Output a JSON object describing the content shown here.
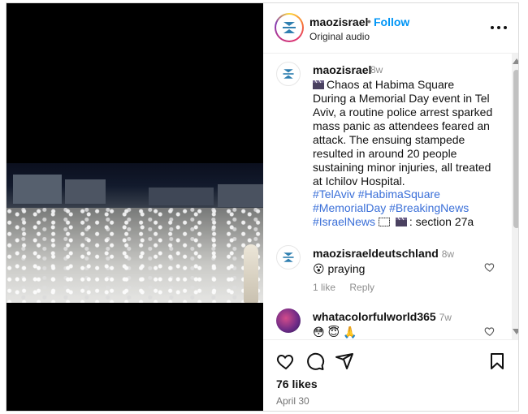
{
  "post": {
    "username": "maozisrael",
    "follow_label": "Follow",
    "dot": "•",
    "audio": "Original audio",
    "more_icon": "more-horizontal-icon"
  },
  "caption": {
    "username": "maozisrael",
    "time": "8w",
    "text": "Chaos at Habima Square\nDuring a Memorial Day event in Tel Aviv, a routine police arrest sparked mass panic as attendees feared an attack. The ensuing stampede resulted in around 20 people sustaining minor injuries, all treated at Ichilov Hospital.",
    "tags": [
      "#TelAviv",
      "#HabimaSquare",
      "#MemorialDay",
      "#BreakingNews",
      "#IsraelNews"
    ],
    "suffix": ": section 27a"
  },
  "comments": [
    {
      "username": "maozisraeldeutschland",
      "time": "8w",
      "text": "😮 praying",
      "likes_label": "1 like",
      "reply_label": "Reply"
    },
    {
      "username": "whatacolorfulworld365",
      "time": "7w",
      "text": "😳 😇 🙏"
    }
  ],
  "footer": {
    "likes": "76 likes",
    "date": "April 30"
  },
  "colors": {
    "follow": "#0095f6",
    "hashtag": "#3a6fd8",
    "logo_blue": "#2f7fb0"
  }
}
